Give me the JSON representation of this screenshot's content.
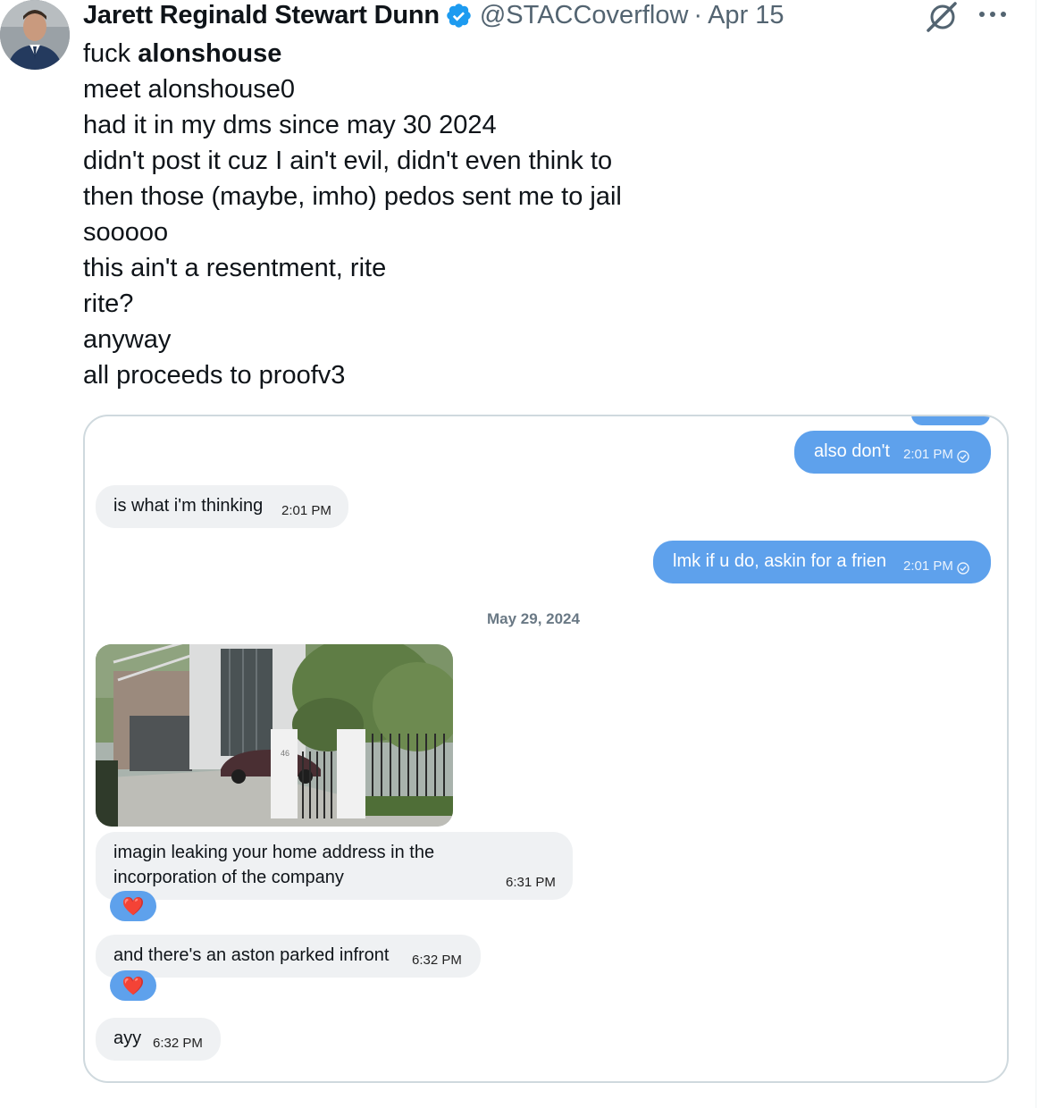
{
  "author": {
    "name": "Jarett Reginald Stewart Dunn",
    "handle": "@STACCoverflow",
    "separator": "·",
    "date": "Apr 15",
    "verified": true
  },
  "icons": {
    "avatar": "avatar",
    "verified": "verified-badge-icon",
    "grok": "grok-icon",
    "more": "more-options-icon",
    "read_receipt": "read-check-icon",
    "reaction": "red-heart-icon"
  },
  "tweet": {
    "line1_prefix": "fuck ",
    "line1_bold": "alonshouse",
    "lines": [
      "meet alonshouse0",
      "had it in my dms since may 30 2024",
      "didn't post it cuz I ain't evil, didn't even think to",
      "then those (maybe, imho) pedos sent me to jail",
      "sooooo",
      "this ain't a resentment, rite",
      "rite?",
      "anyway",
      "all proceeds to proofv3"
    ]
  },
  "chat": {
    "messages": [
      {
        "id": "m1",
        "side": "out",
        "text": "also don't",
        "time": "2:01 PM"
      },
      {
        "id": "m2",
        "side": "in",
        "text": "is what i'm thinking",
        "time": "2:01 PM"
      },
      {
        "id": "m3",
        "side": "out",
        "text": "lmk if u do, askin for a frien",
        "time": "2:01 PM"
      },
      {
        "id": "m5",
        "side": "in",
        "text_lines": [
          "imagin leaking your home address in the",
          "incorporation of the company"
        ],
        "time": "6:31 PM",
        "reaction": "❤️"
      },
      {
        "id": "m6",
        "side": "in",
        "text": "and there's an aston parked infront",
        "time": "6:32 PM",
        "reaction": "❤️"
      },
      {
        "id": "m7",
        "side": "in",
        "text": "ayy",
        "time": "6:32 PM"
      }
    ],
    "date_separator": "May 29, 2024",
    "photo_house_number": "46"
  },
  "colors": {
    "out_bubble": "#5ea1ec",
    "in_bubble": "#eff1f3",
    "verified": "#1d9bf0",
    "secondary_text": "#536471",
    "border": "#cfd9de"
  }
}
